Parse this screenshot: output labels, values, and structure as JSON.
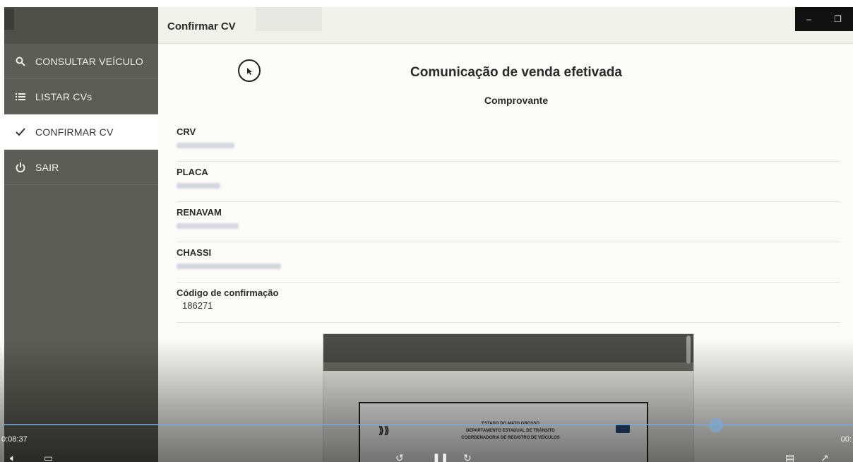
{
  "header": {
    "title": "Confirmar CV"
  },
  "sidebar": {
    "items": [
      {
        "label": "CONSULTAR VEÍCULO",
        "icon": "search-icon",
        "active": false
      },
      {
        "label": "LISTAR CVs",
        "icon": "list-icon",
        "active": false
      },
      {
        "label": "CONFIRMAR CV",
        "icon": "check-icon",
        "active": true
      },
      {
        "label": "SAIR",
        "icon": "power-icon",
        "active": false
      }
    ]
  },
  "main": {
    "heading": "Comunicação de venda efetivada",
    "subheading": "Comprovante",
    "fields": [
      {
        "label": "CRV",
        "value": ""
      },
      {
        "label": "PLACA",
        "value": ""
      },
      {
        "label": "RENAVAM",
        "value": ""
      },
      {
        "label": "CHASSI",
        "value": ""
      },
      {
        "label": "Código de confirmação",
        "value": "186271"
      }
    ]
  },
  "preview": {
    "doc_lines": [
      "ESTADO DO MATO GROSSO",
      "DEPARTAMENTO ESTADUAL DE TRÂNSITO",
      "COORDENADORIA DE REGISTRO DE VEÍCULOS"
    ]
  },
  "video": {
    "time_elapsed": "0:08:37",
    "time_total": "00:"
  },
  "colors": {
    "sidebar_bg": "#5c5d56",
    "header_bg": "#f1f2ec",
    "content_bg": "#fbfbf7",
    "seek_bar": "#78aad7"
  }
}
